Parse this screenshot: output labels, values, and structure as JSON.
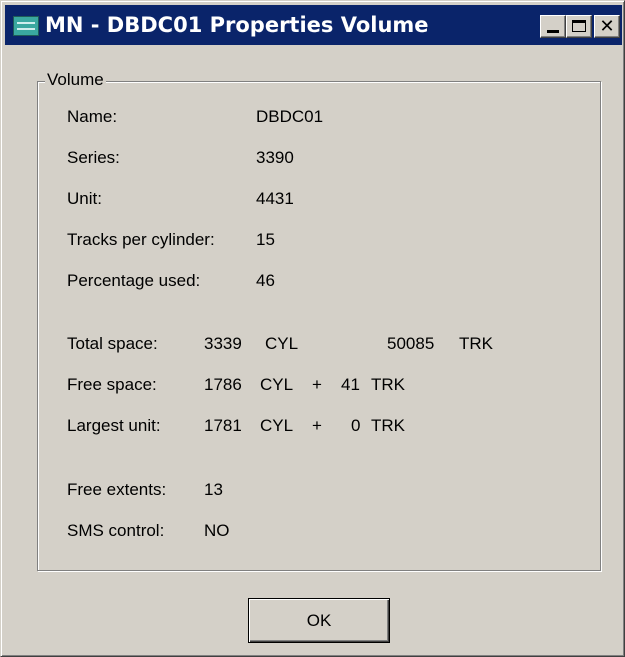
{
  "window": {
    "title": "MN - DBDC01 Properties Volume",
    "icon": "app-window-icon",
    "controls": {
      "minimize": "minimize-icon",
      "maximize": "maximize-icon",
      "close": "close-icon",
      "close_glyph": "✕"
    }
  },
  "group": {
    "label": "Volume"
  },
  "fields": {
    "name": {
      "label": "Name:",
      "value": "DBDC01"
    },
    "series": {
      "label": "Series:",
      "value": "3390"
    },
    "unit": {
      "label": "Unit:",
      "value": "4431"
    },
    "tracks_per_cylinder": {
      "label": "Tracks per cylinder:",
      "value": "15"
    },
    "percentage_used": {
      "label": "Percentage used:",
      "value": "46"
    }
  },
  "space": {
    "total": {
      "label": "Total space:",
      "cyl": "3339",
      "cyl_unit": "CYL",
      "trk": "50085",
      "trk_unit": "TRK"
    },
    "free": {
      "label": "Free space:",
      "cyl": "1786",
      "cyl_unit": "CYL",
      "plus": "+",
      "trk": "41",
      "trk_unit": "TRK"
    },
    "largest": {
      "label": "Largest unit:",
      "cyl": "1781",
      "cyl_unit": "CYL",
      "plus": "+",
      "trk": "0",
      "trk_unit": "TRK"
    }
  },
  "extra": {
    "free_extents": {
      "label": "Free extents:",
      "value": "13"
    },
    "sms_control": {
      "label": "SMS control:",
      "value": "NO"
    }
  },
  "buttons": {
    "ok": "OK"
  },
  "colors": {
    "title_bar": "#0a246a",
    "dialog_face": "#d4d0c8"
  }
}
